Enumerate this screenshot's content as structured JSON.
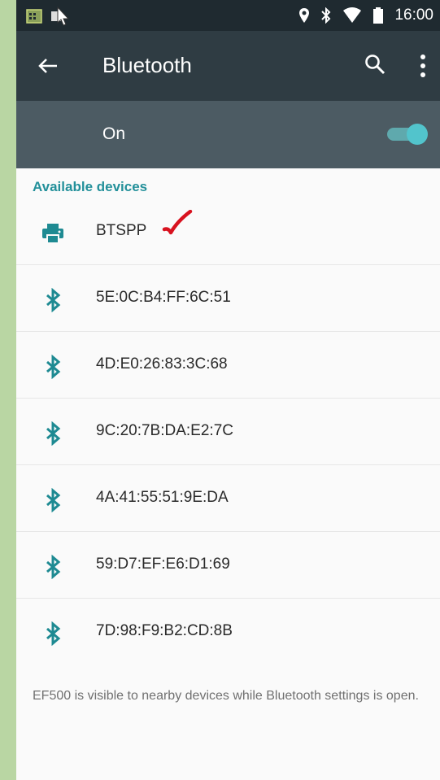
{
  "status_bar": {
    "time": "16:00",
    "icons": [
      "calendar-icon",
      "cursor-icon",
      "location-icon",
      "bluetooth-icon",
      "wifi-icon",
      "battery-icon"
    ]
  },
  "toolbar": {
    "title": "Bluetooth",
    "back_icon": "arrow-left-icon",
    "search_icon": "search-icon",
    "more_icon": "more-vert-icon"
  },
  "bluetooth_toggle": {
    "label": "On",
    "state": "on",
    "accent": "#52c4cc"
  },
  "available_devices": {
    "header": "Available devices",
    "items": [
      {
        "label": "BTSPP",
        "icon": "printer-icon",
        "marked": true
      },
      {
        "label": "5E:0C:B4:FF:6C:51",
        "icon": "bluetooth-icon"
      },
      {
        "label": "4D:E0:26:83:3C:68",
        "icon": "bluetooth-icon"
      },
      {
        "label": "9C:20:7B:DA:E2:7C",
        "icon": "bluetooth-icon"
      },
      {
        "label": "4A:41:55:51:9E:DA",
        "icon": "bluetooth-icon"
      },
      {
        "label": "59:D7:EF:E6:D1:69",
        "icon": "bluetooth-icon"
      },
      {
        "label": "7D:98:F9:B2:CD:8B",
        "icon": "bluetooth-icon"
      }
    ]
  },
  "footer": {
    "text": "EF500 is visible to nearby devices while Bluetooth settings is open."
  },
  "colors": {
    "toolbar_bg": "#2f3c43",
    "switchbar_bg": "#4c5b63",
    "teal": "#23909a",
    "mark_red": "#d8121f"
  }
}
